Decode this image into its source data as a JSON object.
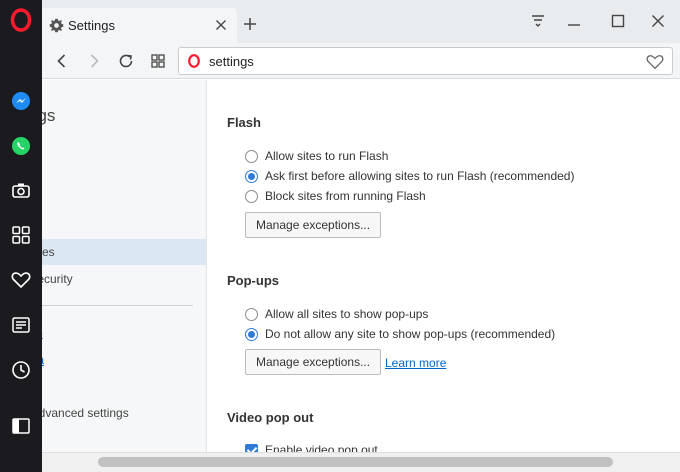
{
  "sidebar": {
    "icons": [
      "opera-logo-icon",
      "messenger-icon",
      "whatsapp-icon",
      "camera-icon",
      "speed-dial-icon",
      "heart-icon",
      "news-icon",
      "history-icon",
      "sidebar-toggle-icon"
    ]
  },
  "tab": {
    "title": "Settings"
  },
  "address_bar": {
    "url": "settings"
  },
  "settings_nav": {
    "title": "ngs",
    "items": [
      {
        "label": "r"
      },
      {
        "label": "es"
      },
      {
        "label": "& security"
      }
    ],
    "links": [
      {
        "label": "help"
      },
      {
        "label": "pera"
      }
    ],
    "advanced": "w advanced settings"
  },
  "flash": {
    "title": "Flash",
    "options": [
      {
        "label": "Allow sites to run Flash",
        "checked": false
      },
      {
        "label": "Ask first before allowing sites to run Flash (recommended)",
        "checked": true
      },
      {
        "label": "Block sites from running Flash",
        "checked": false
      }
    ],
    "manage_label": "Manage exceptions..."
  },
  "popups": {
    "title": "Pop-ups",
    "options": [
      {
        "label": "Allow all sites to show pop-ups",
        "checked": false
      },
      {
        "label": "Do not allow any site to show pop-ups (recommended)",
        "checked": true
      }
    ],
    "manage_label": "Manage exceptions...",
    "learn_more": "Learn more"
  },
  "video_popout": {
    "title": "Video pop out",
    "checkbox_label": "Enable video pop out"
  },
  "colors": {
    "opera_red": "#ff1b2d",
    "accent": "#2f7bd6",
    "link": "#0066cc"
  }
}
